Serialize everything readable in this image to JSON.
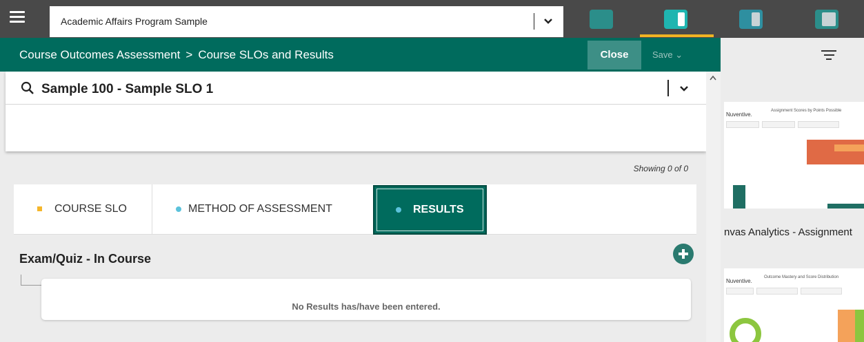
{
  "topbar": {
    "program": "Academic Affairs Program Sample",
    "menu_icon": "hamburger-icon",
    "views": [
      "view-layout-1-icon",
      "view-layout-2-icon",
      "view-layout-3-icon",
      "view-layout-4-icon"
    ]
  },
  "header": {
    "crumb_root": "Course Outcomes Assessment",
    "crumb_sep": ">",
    "crumb_current": "Course SLOs and Results",
    "close_label": "Close",
    "save_label": "Save ⌄"
  },
  "search": {
    "value": "Sample 100 -  Sample SLO 1"
  },
  "showing": "Showing 0 of 0",
  "tabs": [
    {
      "label": "COURSE SLO"
    },
    {
      "label": "METHOD OF ASSESSMENT"
    },
    {
      "label": "RESULTS",
      "active": true
    }
  ],
  "section": {
    "title": "Exam/Quiz - In Course",
    "empty_message": "No Results has/have been entered."
  },
  "right_panel": {
    "thumb1_brand": "Nuventive.",
    "thumb1_title": "Assignment Scores by Points Possible",
    "thumb1_caption": "nvas Analytics - Assignment",
    "thumb2_brand": "Nuventive.",
    "thumb2_title": "Outcome Mastery and Score Distribution"
  },
  "colors": {
    "topbar": "#494949",
    "brand_green": "#006b5d",
    "accent_yellow": "#f0b323",
    "dot_blue": "#5bc2db",
    "dot_orange": "#f5b62b"
  }
}
